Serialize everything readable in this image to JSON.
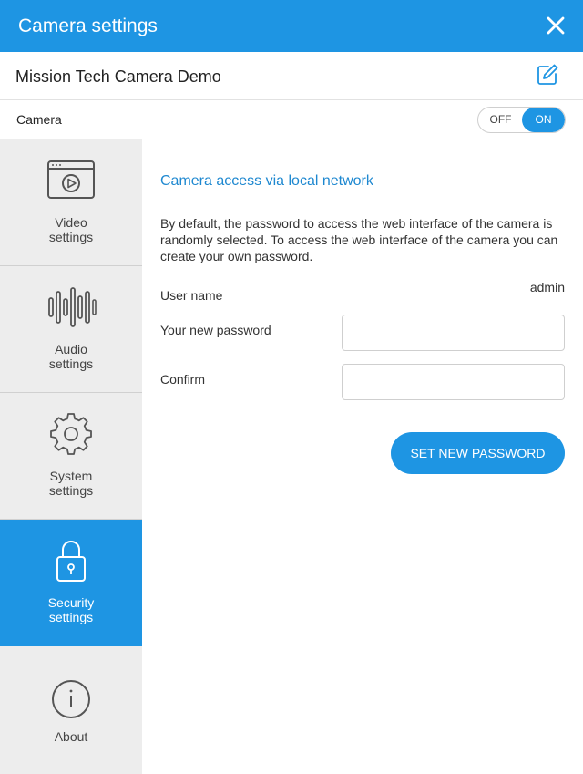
{
  "window": {
    "title": "Camera settings",
    "close_icon": "close-icon"
  },
  "device": {
    "name": "Mission Tech Camera Demo",
    "edit_icon": "edit-icon"
  },
  "camera": {
    "label": "Camera",
    "toggle": {
      "off_label": "OFF",
      "on_label": "ON",
      "state": "on"
    }
  },
  "sidebar": {
    "items": [
      {
        "label_line1": "Video",
        "label_line2": "settings",
        "icon": "video-settings-icon",
        "active": false
      },
      {
        "label_line1": "Audio",
        "label_line2": "settings",
        "icon": "audio-waveform-icon",
        "active": false
      },
      {
        "label_line1": "System",
        "label_line2": "settings",
        "icon": "gear-icon",
        "active": false
      },
      {
        "label_line1": "Security",
        "label_line2": "settings",
        "icon": "lock-icon",
        "active": true
      },
      {
        "label_line1": "About",
        "label_line2": "",
        "icon": "info-icon",
        "active": false
      }
    ]
  },
  "security": {
    "heading": "Camera access via local network",
    "description": "By default, the password to access the web interface of the camera is randomly selected. To access the web interface of the camera you can create your own password.",
    "username_label": "User name",
    "username_value": "admin",
    "new_password_label": "Your new password",
    "new_password_value": "",
    "confirm_label": "Confirm",
    "confirm_value": "",
    "submit_label": "SET NEW PASSWORD"
  },
  "colors": {
    "accent": "#1e95e3",
    "heading": "#1e88d0",
    "sidebar_bg": "#ededed"
  }
}
